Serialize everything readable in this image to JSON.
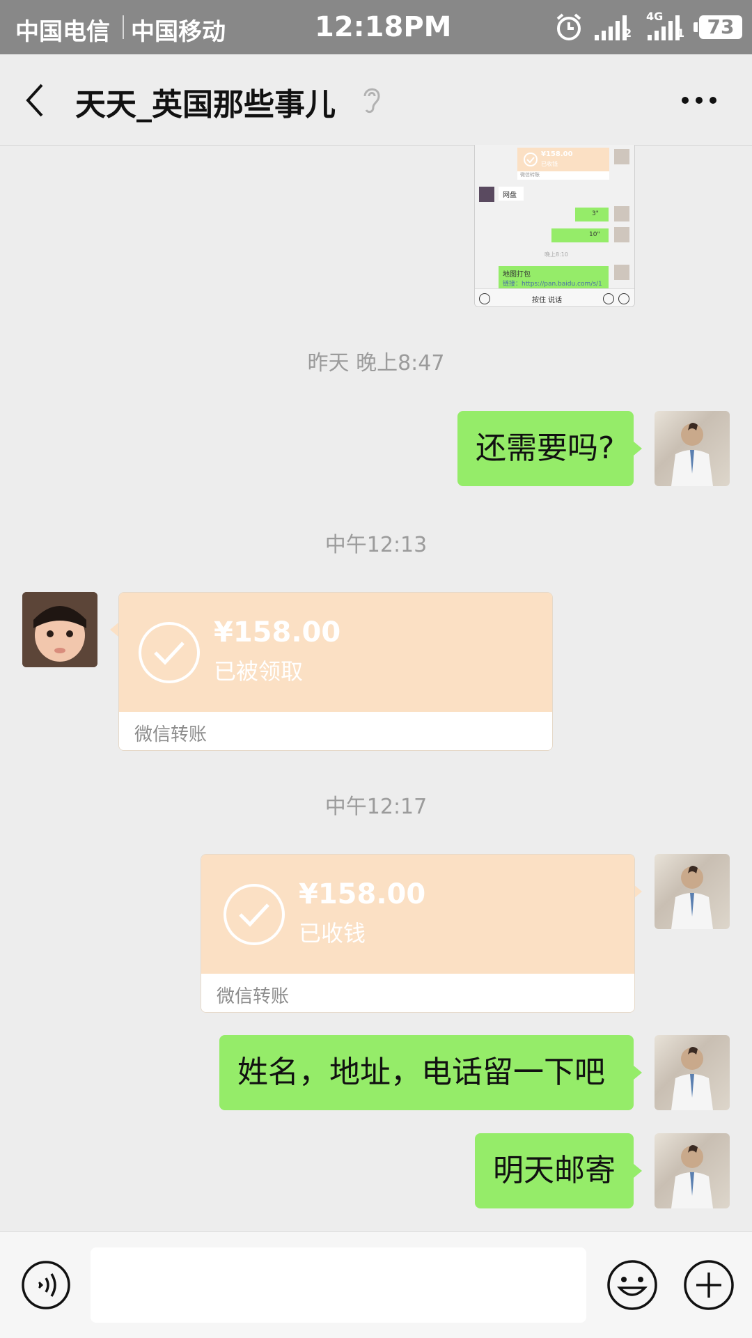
{
  "status_bar": {
    "carrier1": "中国电信",
    "carrier2": "中国移动",
    "time": "12:18PM",
    "sim1_badge": "2",
    "sim2_badge": "1",
    "network": "4G",
    "battery": "73"
  },
  "header": {
    "title": "天天_英国那些事儿",
    "icons": [
      "back-icon",
      "ear-icon",
      "more-icon"
    ]
  },
  "thumbnail": {
    "amount": "¥158.00",
    "status": "已收钱",
    "foot": "微信转账",
    "netdisk": "网盘",
    "voice1": "3\"",
    "voice2": "10\"",
    "time": "晚上8:10",
    "map_pack": "地图打包",
    "link": "链接：https://pan.baidu.com/s/1",
    "hold_to_talk": "按住 说话"
  },
  "messages": {
    "time1": "昨天 晚上8:47",
    "msg1": "还需要吗?",
    "time2": "中午12:13",
    "transfer1": {
      "amount": "¥158.00",
      "status": "已被领取",
      "label": "微信转账"
    },
    "time3": "中午12:17",
    "transfer2": {
      "amount": "¥158.00",
      "status": "已收钱",
      "label": "微信转账"
    },
    "msg2": "姓名，地址，电话留一下吧",
    "msg3": "明天邮寄"
  },
  "input_bar": {
    "placeholder": "",
    "icons": [
      "voice-icon",
      "emoji-icon",
      "plus-icon"
    ]
  },
  "colors": {
    "bubble_green": "#95ec69",
    "transfer_orange": "#fbe0c4",
    "status_bar": "#888888",
    "background": "#ededed"
  }
}
